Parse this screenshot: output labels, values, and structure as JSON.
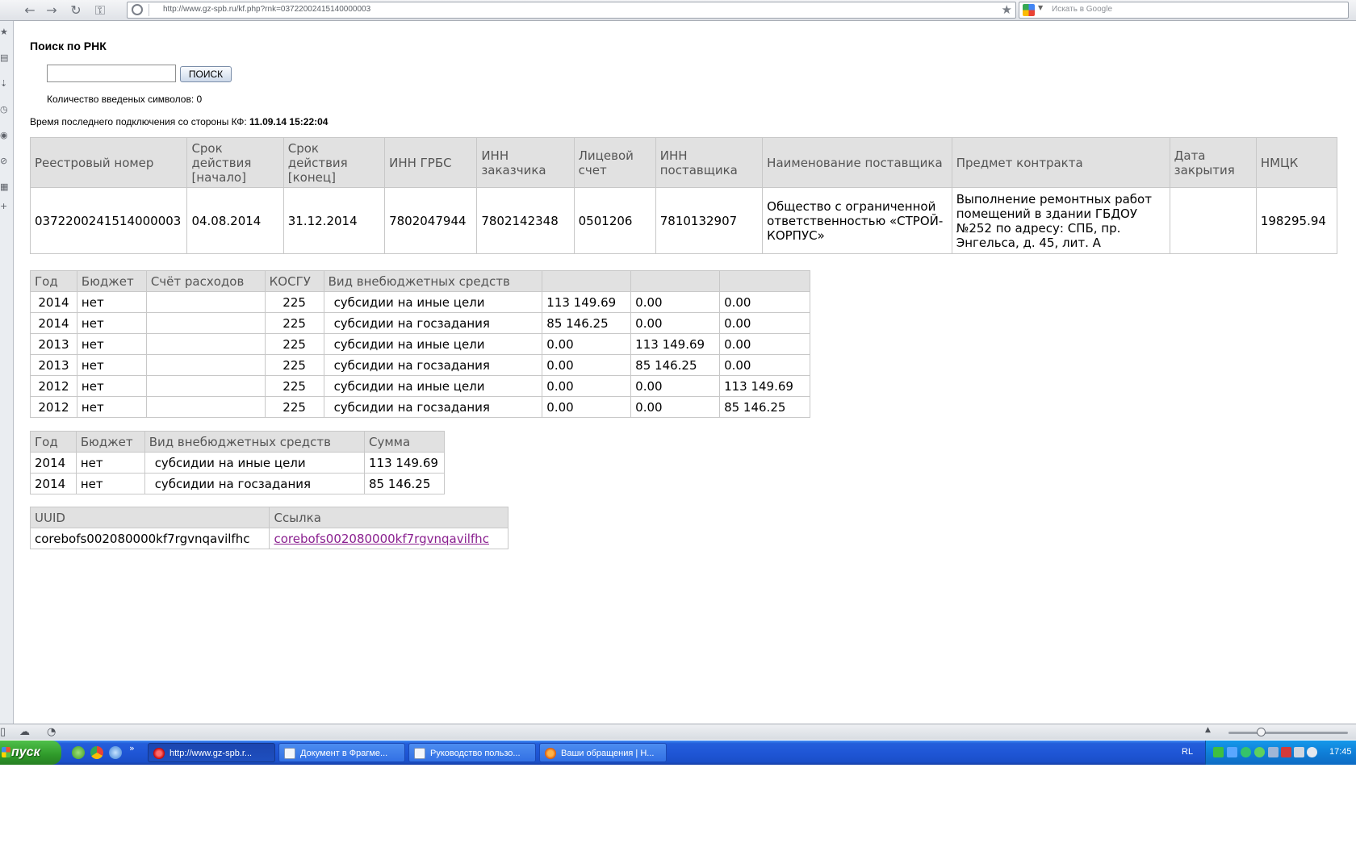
{
  "browser": {
    "url": "http://www.gz-spb.ru/kf.php?rnk=03722002415140000003",
    "search_placeholder": "Искать в Google"
  },
  "page": {
    "title": "Поиск по РНК",
    "search_input_value": "",
    "search_button": "ПОИСК",
    "char_count_label": "Количество введеных символов: 0",
    "last_connection_label": "Время последнего подключения со стороны КФ: ",
    "last_connection_value": "11.09.14 15:22:04"
  },
  "contract_table": {
    "headers": [
      "Реестровый номер",
      "Срок действия [начало]",
      "Срок действия [конец]",
      "ИНН ГРБС",
      "ИНН заказчика",
      "Лицевой счет",
      "ИНН поставщика",
      "Наименование поставщика",
      "Предмет контракта",
      "Дата закрытия",
      "НМЦК"
    ],
    "row": [
      "0372200241514000003",
      "04.08.2014",
      "31.12.2014",
      "7802047944",
      "7802142348",
      "0501206",
      "7810132907",
      "Общество с ограниченной ответственностью «СТРОЙ-КОРПУС»",
      "Выполнение ремонтных работ помещений в здании ГБДОУ №252 по адресу: СПБ, пр. Энгельса, д. 45, лит. А",
      "",
      "198295.94"
    ]
  },
  "budget_table": {
    "headers": [
      "Год",
      "Бюджет",
      "Счёт расходов",
      "КОСГУ",
      "Вид внебюджетных средств",
      "",
      "",
      ""
    ],
    "rows": [
      [
        "2014",
        "нет",
        "",
        "225",
        "субсидии на иные цели",
        "113 149.69",
        "0.00",
        "0.00"
      ],
      [
        "2014",
        "нет",
        "",
        "225",
        "субсидии на госзадания",
        "85 146.25",
        "0.00",
        "0.00"
      ],
      [
        "2013",
        "нет",
        "",
        "225",
        "субсидии на иные цели",
        "0.00",
        "113 149.69",
        "0.00"
      ],
      [
        "2013",
        "нет",
        "",
        "225",
        "субсидии на госзадания",
        "0.00",
        "85 146.25",
        "0.00"
      ],
      [
        "2012",
        "нет",
        "",
        "225",
        "субсидии на иные цели",
        "0.00",
        "0.00",
        "113 149.69"
      ],
      [
        "2012",
        "нет",
        "",
        "225",
        "субсидии на госзадания",
        "0.00",
        "0.00",
        "85 146.25"
      ]
    ]
  },
  "sum_table": {
    "headers": [
      "Год",
      "Бюджет",
      "Вид внебюджетных средств",
      "Сумма"
    ],
    "rows": [
      [
        "2014",
        "нет",
        "субсидии на иные цели",
        "113 149.69"
      ],
      [
        "2014",
        "нет",
        "субсидии на госзадания",
        "85 146.25"
      ]
    ]
  },
  "uuid_table": {
    "headers": [
      "UUID",
      "Ссылка"
    ],
    "row": [
      "corebofs002080000kf7rgvnqavilfhc",
      "corebofs002080000kf7rgvnqavilfhc"
    ]
  },
  "taskbar": {
    "start_label": "пуск",
    "more": "»",
    "tasks": [
      {
        "label": "http://www.gz-spb.r...",
        "icon": "opera-icon"
      },
      {
        "label": "Документ в Фрагме...",
        "icon": "document-icon"
      },
      {
        "label": "Руководство пользо...",
        "icon": "document-icon"
      },
      {
        "label": "Ваши обращения | Н...",
        "icon": "firefox-icon"
      }
    ],
    "language": "RL",
    "clock": "17:45"
  },
  "colors": {
    "link_visited": "#8a1f8f",
    "table_header_bg": "#e1e1e1",
    "taskbar_blue": "#245edb",
    "start_green": "#2f9a2a"
  }
}
